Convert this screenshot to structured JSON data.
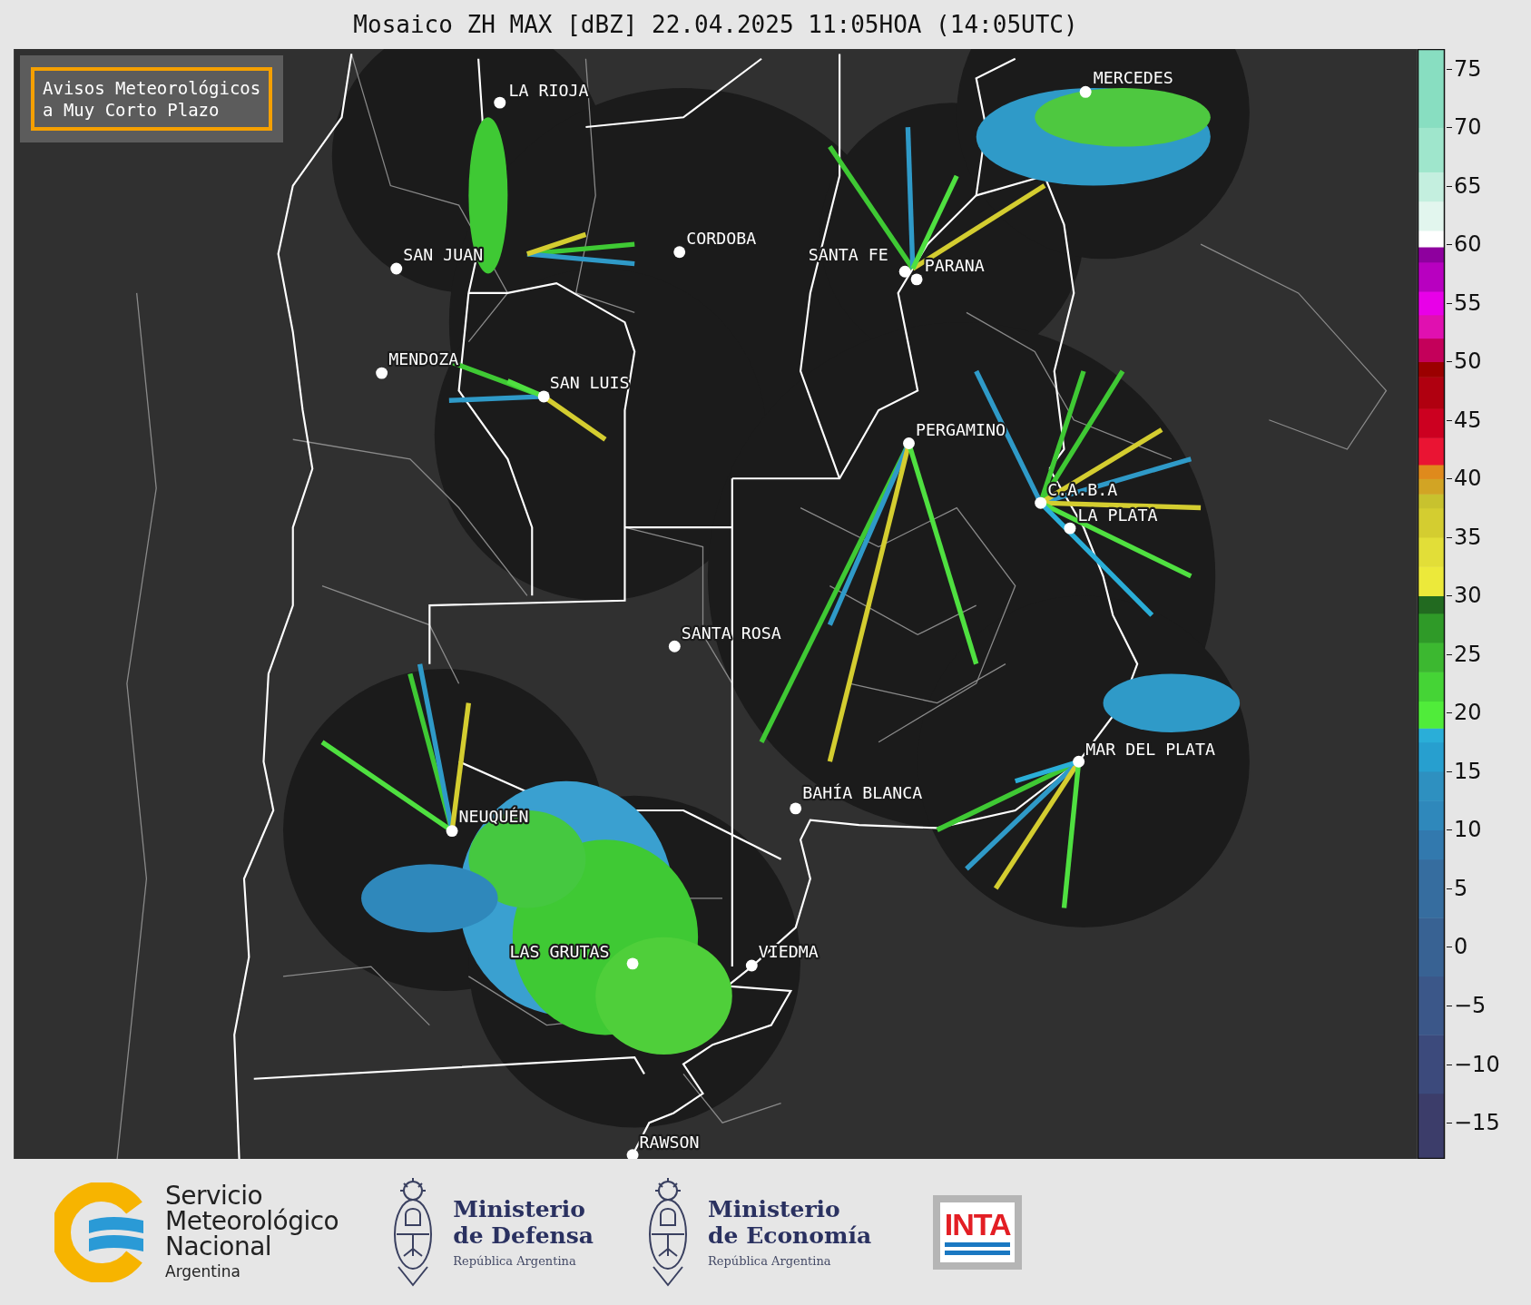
{
  "title": "Mosaico ZH MAX [dBZ] 22.04.2025 11:05HOA (14:05UTC)",
  "notice": {
    "lines": [
      "Avisos Meteorológicos",
      "a Muy Corto Plazo"
    ]
  },
  "cities": [
    {
      "name": "MERCEDES"
    },
    {
      "name": "LA RIOJA"
    },
    {
      "name": "CORDOBA"
    },
    {
      "name": "SAN JUAN"
    },
    {
      "name": "SANTA FE"
    },
    {
      "name": "PARANA"
    },
    {
      "name": "MENDOZA"
    },
    {
      "name": "SAN LUIS"
    },
    {
      "name": "PERGAMINO"
    },
    {
      "name": "C.A.B.A"
    },
    {
      "name": "LA PLATA"
    },
    {
      "name": "SANTA ROSA"
    },
    {
      "name": "MAR DEL PLATA"
    },
    {
      "name": "BAHÍA BLANCA"
    },
    {
      "name": "NEUQUÉN"
    },
    {
      "name": "LAS GRUTAS"
    },
    {
      "name": "VIEDMA"
    },
    {
      "name": "RAWSON"
    }
  ],
  "colorbar": {
    "ticks": [
      "75",
      "70",
      "65",
      "60",
      "55",
      "50",
      "45",
      "40",
      "35",
      "30",
      "25",
      "20",
      "15",
      "10",
      "5",
      "0",
      "−5",
      "−10",
      "−15"
    ]
  },
  "footer": {
    "logos": [
      {
        "kind": "smn",
        "lines": [
          "Servicio",
          "Meteorológico",
          "Nacional"
        ],
        "subtitle": "Argentina"
      },
      {
        "kind": "ministry",
        "lines": [
          "Ministerio",
          "de Defensa"
        ],
        "subtitle": "República Argentina"
      },
      {
        "kind": "ministry",
        "lines": [
          "Ministerio",
          "de Economía"
        ],
        "subtitle": "República Argentina"
      },
      {
        "kind": "badge",
        "text": "INTA"
      }
    ]
  }
}
